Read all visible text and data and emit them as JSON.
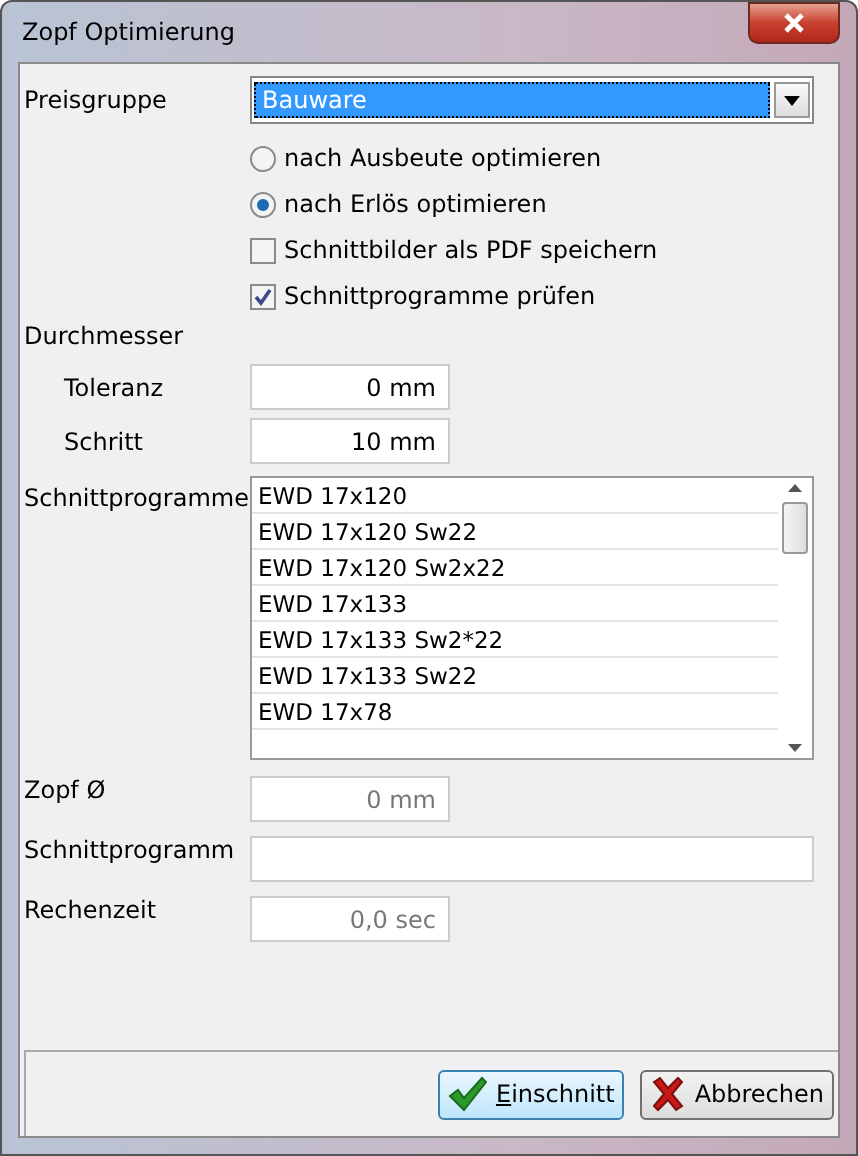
{
  "window": {
    "title": "Zopf Optimierung"
  },
  "preisgruppe": {
    "label": "Preisgruppe",
    "value": "Bauware"
  },
  "options": [
    {
      "kind": "radio",
      "label": "nach Ausbeute optimieren",
      "checked": false
    },
    {
      "kind": "radio",
      "label": "nach Erlös optimieren",
      "checked": true
    },
    {
      "kind": "checkbox",
      "label": "Schnittbilder als PDF speichern",
      "checked": false
    },
    {
      "kind": "checkbox",
      "label": "Schnittprogramme prüfen",
      "checked": true
    }
  ],
  "durchmesser": {
    "label": "Durchmesser",
    "fields": [
      {
        "label": "Toleranz",
        "value": "0 mm"
      },
      {
        "label": "Schritt",
        "value": "10 mm"
      }
    ]
  },
  "schnittprogramme": {
    "label": "Schnittprogramme",
    "items": [
      "EWD 17x120",
      "EWD 17x120 Sw22",
      "EWD 17x120 Sw2x22",
      "EWD 17x133",
      "EWD 17x133 Sw2*22",
      "EWD 17x133 Sw22",
      "EWD 17x78"
    ]
  },
  "results": [
    {
      "label": "Zopf Ø",
      "value": "0 mm",
      "disabled": true,
      "wide": false
    },
    {
      "label": "Schnittprogramm",
      "disabled": false,
      "wide": true
    },
    {
      "label": "Rechenzeit",
      "value": "0,0 sec",
      "disabled": true,
      "wide": false
    }
  ],
  "buttons": [
    {
      "kind": "ok",
      "label": "Einschnitt"
    },
    {
      "kind": "cancel",
      "label": "Abbrechen"
    }
  ]
}
